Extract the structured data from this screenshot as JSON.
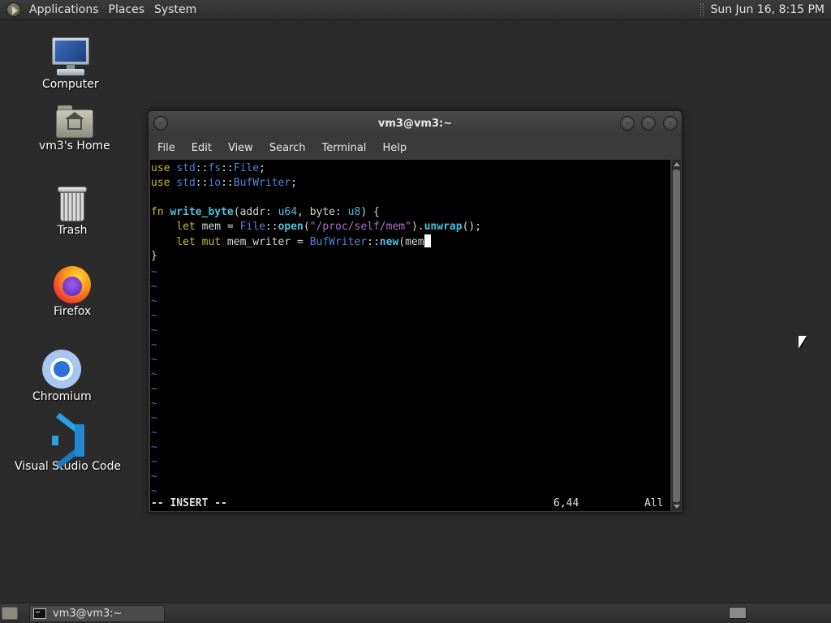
{
  "top_panel": {
    "menus": [
      "Applications",
      "Places",
      "System"
    ],
    "clock": "Sun Jun 16,  8:15 PM"
  },
  "desktop": {
    "icons": [
      {
        "label": "Computer",
        "icon": "computer-icon"
      },
      {
        "label": "vm3's Home",
        "icon": "home-folder-icon"
      },
      {
        "label": "Trash",
        "icon": "trash-icon"
      },
      {
        "label": "Firefox",
        "icon": "firefox-icon"
      },
      {
        "label": "Chromium",
        "icon": "chromium-icon"
      },
      {
        "label": "Visual Studio Code",
        "icon": "vscode-icon"
      }
    ]
  },
  "terminal": {
    "title": "vm3@vm3:~",
    "menu": [
      "File",
      "Edit",
      "View",
      "Search",
      "Terminal",
      "Help"
    ],
    "code_lines": [
      "use std::fs::File;",
      "use std::io::BufWriter;",
      "",
      "fn write_byte(addr: u64, byte: u8) {",
      "    let mem = File::open(\"/proc/self/mem\").unwrap();",
      "    let mut mem_writer = BufWriter::new(mem",
      "}"
    ],
    "tilde": "~",
    "empty_line_count_label": "16",
    "status": {
      "mode": "-- INSERT --",
      "position": "6,44",
      "scroll": "All"
    }
  },
  "bottom_panel": {
    "task_label": "vm3@vm3:~"
  },
  "colors": {
    "keyword": "#cdb73a",
    "namespace": "#4a86d8",
    "function": "#4dc0e0",
    "string": "#b070c8",
    "tilde": "#6060c8"
  }
}
